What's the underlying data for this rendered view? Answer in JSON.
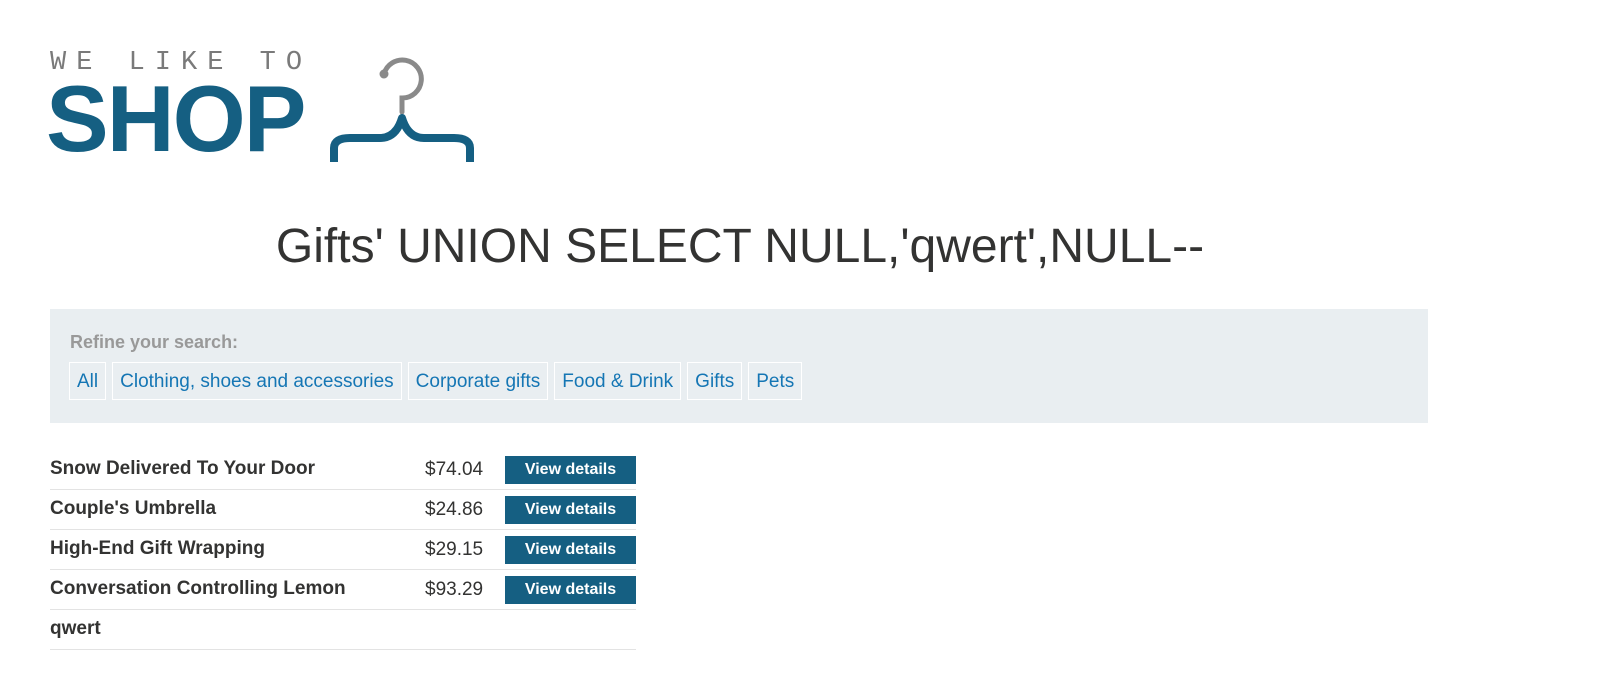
{
  "logo": {
    "tagline": "WE LIKE TO",
    "word": "SHOP",
    "colors": {
      "primary": "#155f82",
      "tagline": "#7a7a7a",
      "hanger_hook": "#8a8a8a"
    }
  },
  "page": {
    "title": "Gifts' UNION SELECT NULL,'qwert',NULL--"
  },
  "filter": {
    "label": "Refine your search:",
    "categories": [
      {
        "label": "All"
      },
      {
        "label": "Clothing, shoes and accessories"
      },
      {
        "label": "Corporate gifts"
      },
      {
        "label": "Food & Drink"
      },
      {
        "label": "Gifts"
      },
      {
        "label": "Pets"
      }
    ],
    "background": "#e9eef1",
    "link_color": "#1576b4"
  },
  "products": [
    {
      "name": "Snow Delivered To Your Door",
      "price": "$74.04",
      "button": "View details"
    },
    {
      "name": "Couple's Umbrella",
      "price": "$24.86",
      "button": "View details"
    },
    {
      "name": "High-End Gift Wrapping",
      "price": "$29.15",
      "button": "View details"
    },
    {
      "name": "Conversation Controlling Lemon",
      "price": "$93.29",
      "button": "View details"
    },
    {
      "name": "qwert",
      "price": "",
      "button": ""
    }
  ]
}
